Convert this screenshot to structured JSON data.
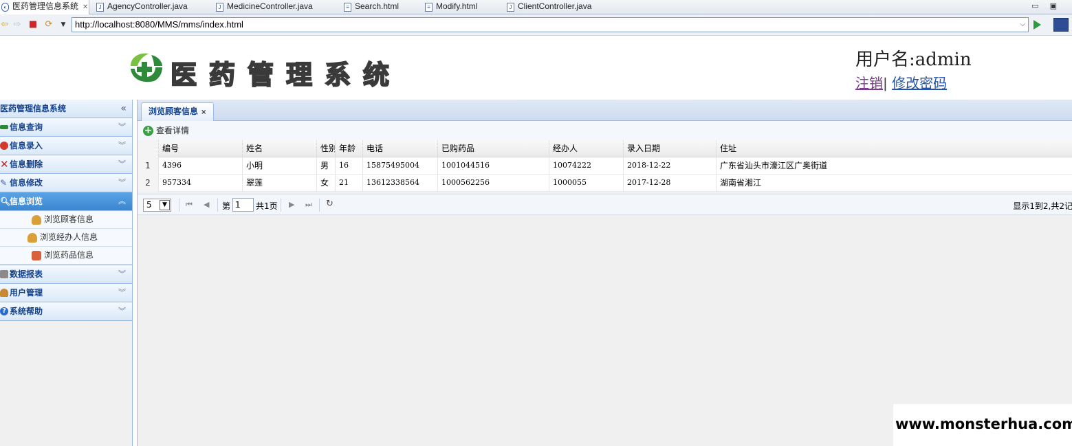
{
  "editor_tabs": [
    {
      "label": "医药管理信息系统",
      "active": true,
      "icon": "browser-icon"
    },
    {
      "label": "AgencyController.java",
      "icon": "java-file-icon"
    },
    {
      "label": "MedicineController.java",
      "icon": "java-file-icon"
    },
    {
      "label": "Search.html",
      "icon": "html-file-icon"
    },
    {
      "label": "Modify.html",
      "icon": "html-file-icon"
    },
    {
      "label": "ClientController.java",
      "icon": "java-file-icon"
    }
  ],
  "browser": {
    "url": "http://localhost:8080/MMS/mms/index.html"
  },
  "header": {
    "logo_text": "医药管理系统",
    "username": "用户名:admin",
    "logout": "注销",
    "separator": "|",
    "change_password": "修改密码"
  },
  "sidebar": {
    "title": "医药管理信息系统",
    "sections": [
      {
        "label": "信息查询",
        "icon": "search-bar-icon",
        "color": "#2a8a3a"
      },
      {
        "label": "信息录入",
        "icon": "entry-icon",
        "color": "#d23a2a"
      },
      {
        "label": "信息删除",
        "icon": "delete-icon",
        "color": "#d02020"
      },
      {
        "label": "信息修改",
        "icon": "edit-icon",
        "color": "#3a5ab0"
      },
      {
        "label": "信息浏览",
        "icon": "browse-icon",
        "color": "#ffffff",
        "open": true
      },
      {
        "label": "数据报表",
        "icon": "report-icon",
        "color": "#555555"
      },
      {
        "label": "用户管理",
        "icon": "user-icon",
        "color": "#c88a30"
      },
      {
        "label": "系统帮助",
        "icon": "help-icon",
        "color": "#2a6ad0"
      }
    ],
    "browse_items": [
      {
        "label": "浏览顾客信息"
      },
      {
        "label": "浏览经办人信息"
      },
      {
        "label": "浏览药品信息"
      }
    ]
  },
  "panel": {
    "tab_label": "浏览顾客信息",
    "view_detail": "查看详情",
    "columns": [
      "编号",
      "姓名",
      "性别",
      "年龄",
      "电话",
      "已购药品",
      "经办人",
      "录入日期",
      "住址"
    ],
    "rows": [
      {
        "num": "1",
        "id": "4396",
        "name": "小明",
        "sex": "男",
        "age": "16",
        "phone": "15875495004",
        "medicine": "1001044516",
        "agent": "10074222",
        "date": "2018-12-22",
        "address": "广东省汕头市濠江区广奥街道"
      },
      {
        "num": "2",
        "id": "957334",
        "name": "翠莲",
        "sex": "女",
        "age": "21",
        "phone": "13612338564",
        "medicine": "1000562256",
        "agent": "1000055",
        "date": "2017-12-28",
        "address": "湖南省湘江"
      }
    ],
    "pager": {
      "page_size": "5",
      "page_prefix": "第",
      "page_value": "1",
      "page_total": "共1页",
      "info": "显示1到2,共2记"
    }
  },
  "watermark": "www.monsterhua.com"
}
